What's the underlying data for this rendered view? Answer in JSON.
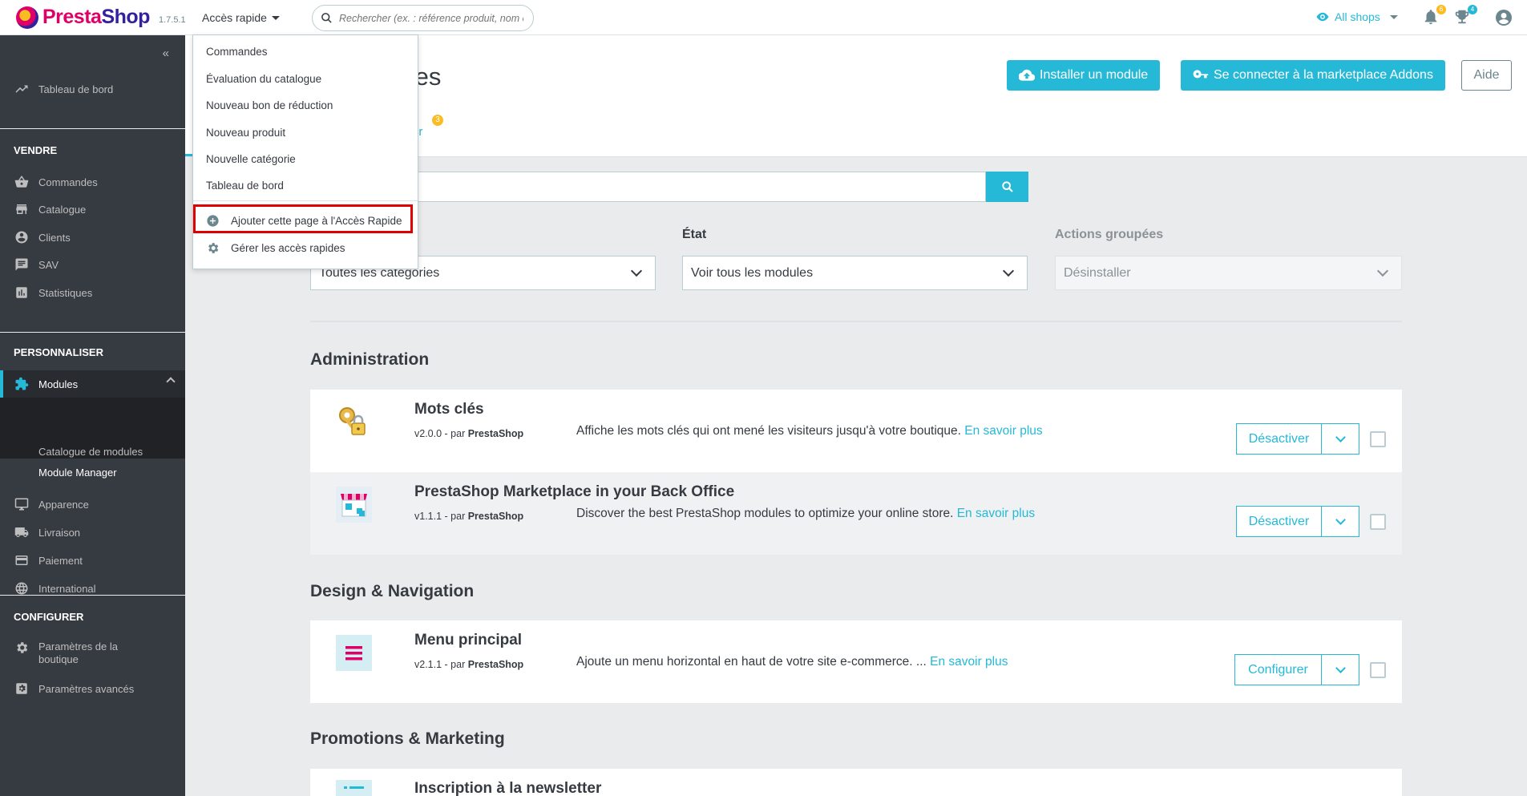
{
  "header": {
    "logo": "PrestaShop",
    "version": "1.7.5.1",
    "quick_access_label": "Accès rapide",
    "search_placeholder": "Rechercher (ex. : référence produit, nom c",
    "all_shops_label": "All shops",
    "notifications_count": "6",
    "orders_count": "4"
  },
  "quick_access_menu": {
    "items": [
      "Commandes",
      "Évaluation du catalogue",
      "Nouveau bon de réduction",
      "Nouveau produit",
      "Nouvelle catégorie",
      "Tableau de bord"
    ],
    "add_page_label": "Ajouter cette page à l'Accès Rapide",
    "manage_label": "Gérer les accès rapides"
  },
  "sidebar": {
    "dashboard": "Tableau de bord",
    "section_sell": "VENDRE",
    "sell_items": [
      "Commandes",
      "Catalogue",
      "Clients",
      "SAV",
      "Statistiques"
    ],
    "section_customize": "PERSONNALISER",
    "modules_label": "Modules",
    "modules_sub": [
      "Catalogue de modules",
      "Module Manager"
    ],
    "customize_items": [
      "Apparence",
      "Livraison",
      "Paiement",
      "International"
    ],
    "section_configure": "CONFIGURER",
    "configure_items": [
      "Paramètres de la boutique",
      "Paramètres avancés"
    ]
  },
  "page": {
    "title_fragment": "odules",
    "tab_fragment": "ur",
    "tab_badge": "3",
    "install_button": "Installer un module",
    "connect_button": "Se connecter à la marketplace Addons",
    "help_button": "Aide"
  },
  "filters": {
    "category_value": "Toutes les catégories",
    "status_label": "État",
    "status_value": "Voir tous les modules",
    "bulk_label": "Actions groupées",
    "bulk_value": "Désinstaller"
  },
  "categories": [
    {
      "title": "Administration",
      "modules": [
        {
          "name": "Mots clés",
          "version": "v2.0.0 - par",
          "author": "PrestaShop",
          "description": "Affiche les mots clés qui ont mené les visiteurs jusqu'à votre boutique.",
          "link": "En savoir plus",
          "action": "Désactiver",
          "icon": "keys-lock-icon"
        },
        {
          "name": "PrestaShop Marketplace in your Back Office",
          "version": "v1.1.1 - par",
          "author": "PrestaShop",
          "description": "Discover the best PrestaShop modules to optimize your online store.",
          "link": "En savoir plus",
          "action": "Désactiver",
          "icon": "marketplace-store-icon"
        }
      ]
    },
    {
      "title": "Design & Navigation",
      "modules": [
        {
          "name": "Menu principal",
          "version": "v2.1.1 - par",
          "author": "PrestaShop",
          "description": "Ajoute un menu horizontal en haut de votre site e-commerce. ...",
          "link": "En savoir plus",
          "action": "Configurer",
          "icon": "main-menu-icon"
        }
      ]
    },
    {
      "title": "Promotions & Marketing",
      "modules": [
        {
          "name": "Inscription à la newsletter",
          "icon": "newsletter-icon"
        }
      ]
    }
  ],
  "colors": {
    "accent": "#25b9d7",
    "sidebar_bg": "#363a41",
    "brand_pink": "#df0067",
    "highlight_red": "#e00000"
  }
}
